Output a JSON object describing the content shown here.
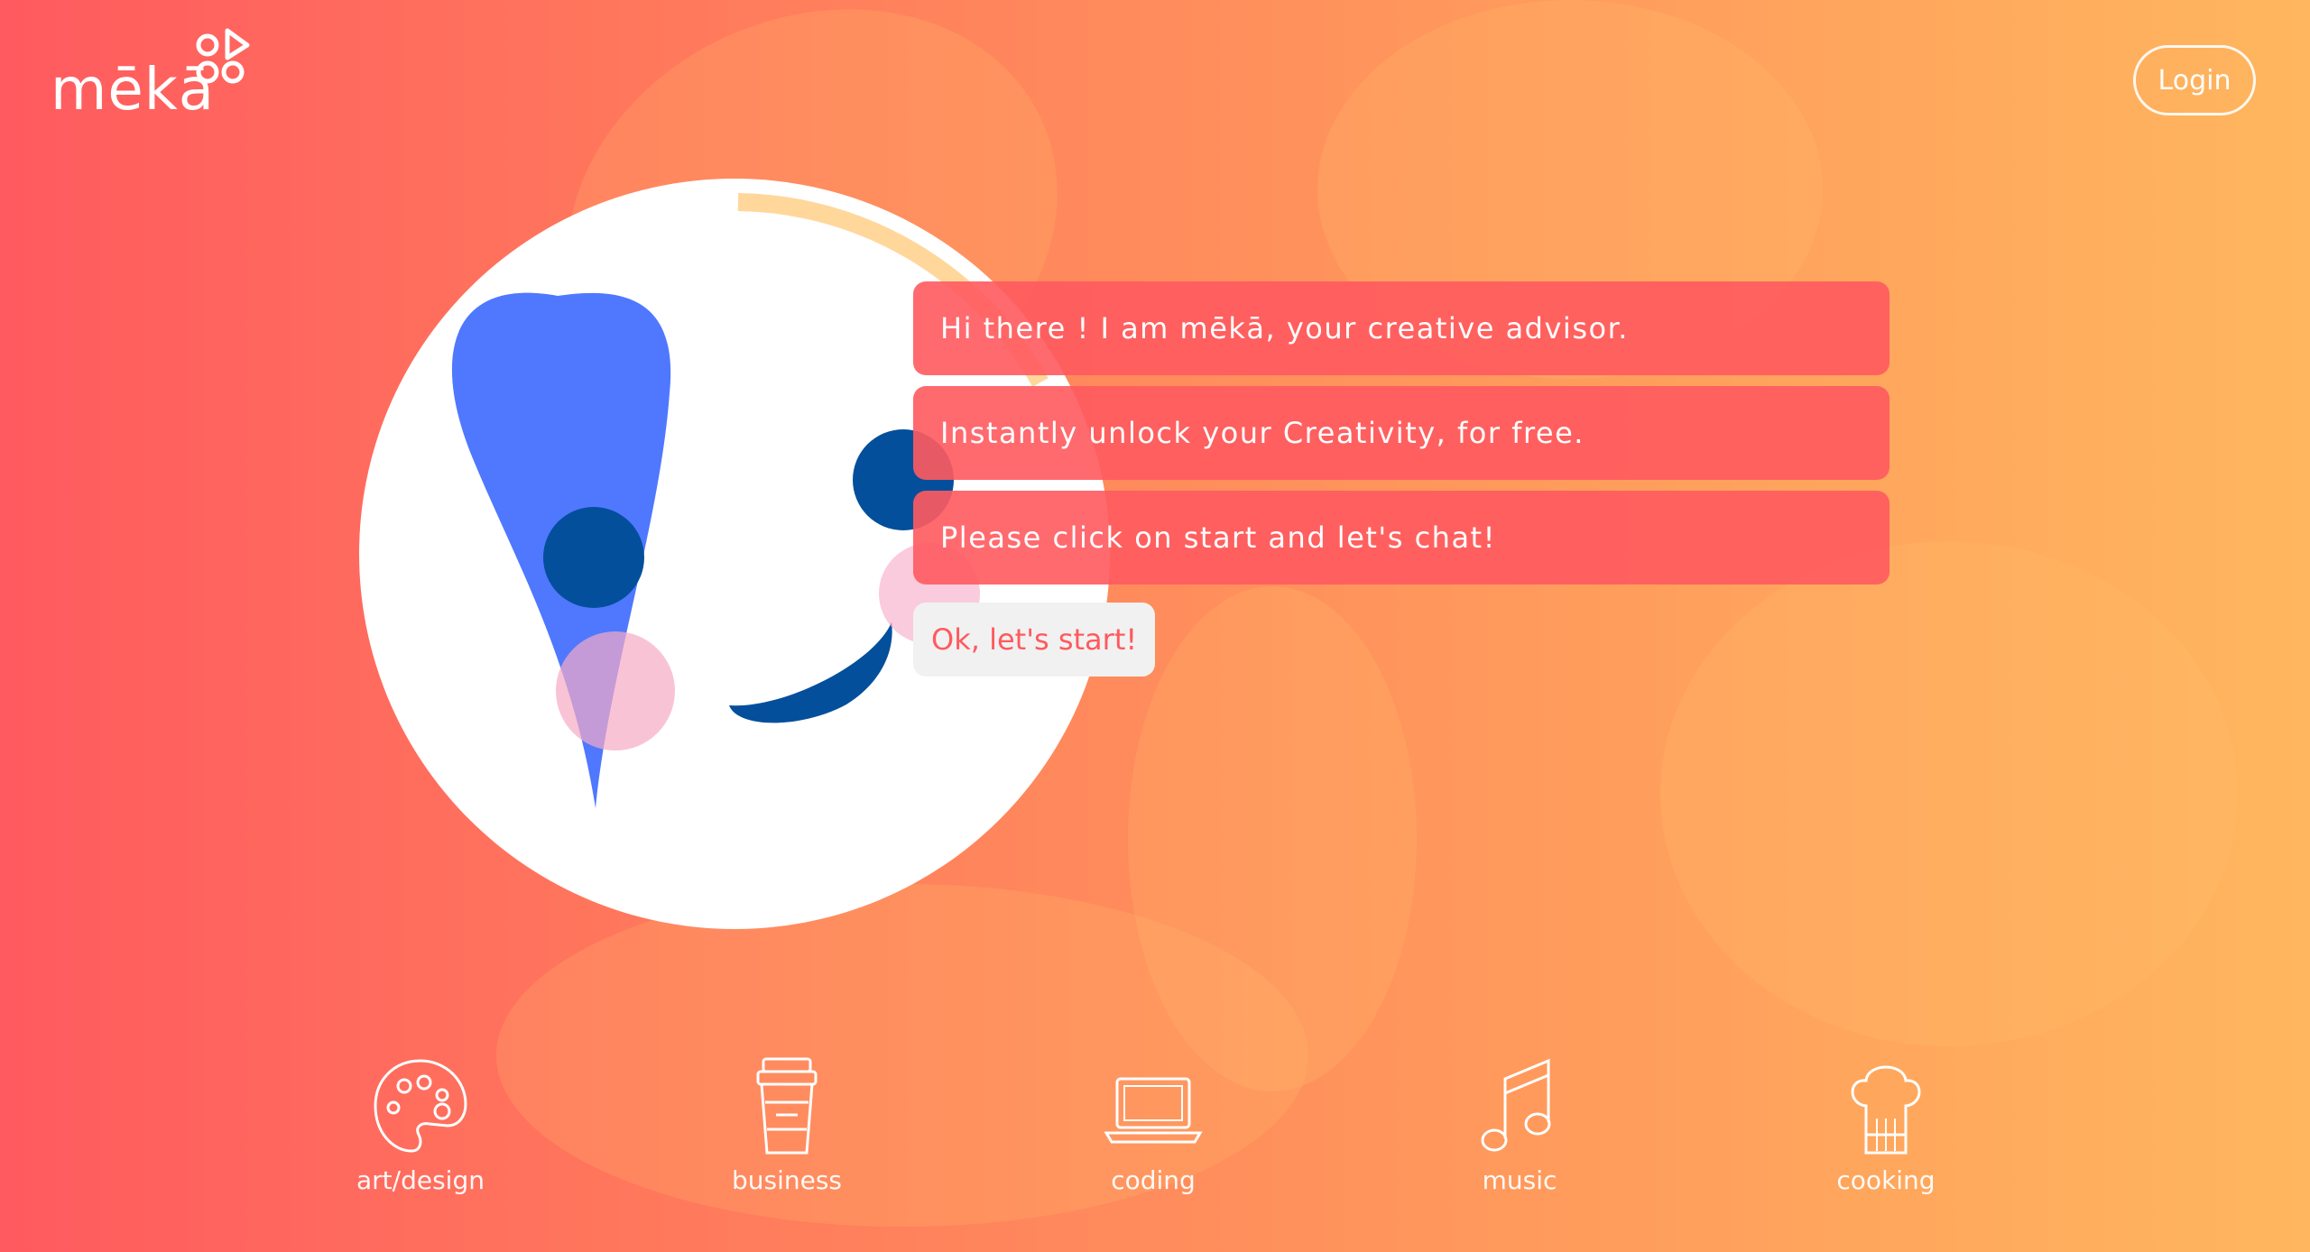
{
  "brand": {
    "name": "mēkā",
    "logo_icon": "meka-logo-icon"
  },
  "header": {
    "login_label": "Login"
  },
  "colors": {
    "background_left": "#ff5a5f",
    "background_right": "#ffb65e",
    "bubble": "#ff5a5f",
    "avatar_blue": "#4f78ff",
    "avatar_navy": "#034f9c",
    "avatar_pink": "#f7a9c5",
    "arc_yellow": "#ffd08a"
  },
  "chat": {
    "messages": [
      "Hi there ! I am mēkā, your creative advisor.",
      "Instantly unlock your Creativity, for free.",
      "Please click on start and let's chat!"
    ],
    "start_label": "Ok, let's start!"
  },
  "categories": [
    {
      "label": "art/design",
      "icon": "palette-icon"
    },
    {
      "label": "business",
      "icon": "coffee-cup-icon"
    },
    {
      "label": "coding",
      "icon": "laptop-icon"
    },
    {
      "label": "music",
      "icon": "music-note-icon"
    },
    {
      "label": "cooking",
      "icon": "chef-hat-icon"
    }
  ]
}
